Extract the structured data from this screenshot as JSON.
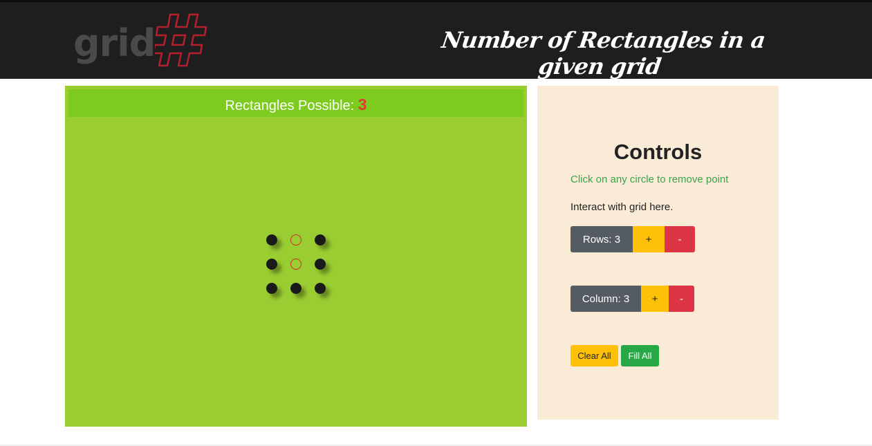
{
  "header": {
    "logo_text": "grid",
    "logo_symbol": "#",
    "title": "Number of Rectangles in a given grid"
  },
  "grid": {
    "count_label": "Rectangles Possible:",
    "count_value": "3",
    "rows": 3,
    "columns": 3,
    "cells": [
      [
        true,
        false,
        true
      ],
      [
        true,
        false,
        true
      ],
      [
        true,
        true,
        true
      ]
    ]
  },
  "controls": {
    "title": "Controls",
    "hint": "Click on any circle to remove point",
    "interact_text": "Interact with grid here.",
    "rows_label": "Rows: 3",
    "columns_label": "Column: 3",
    "plus_label": "+",
    "minus_label": "-",
    "clear_all_label": "Clear All",
    "fill_all_label": "Fill All"
  },
  "colors": {
    "header_bg": "#1e1e1e",
    "grid_bg": "#9acd32",
    "count_bar_bg": "#7ccb1e",
    "count_value": "#e0392f",
    "controls_bg": "#faebd7",
    "hint": "#3aa34a",
    "label_btn": "#545b62",
    "plus_btn": "#ffc107",
    "minus_btn": "#dc3545",
    "fill_btn": "#28a745",
    "logo_hash": "#b5202e"
  }
}
